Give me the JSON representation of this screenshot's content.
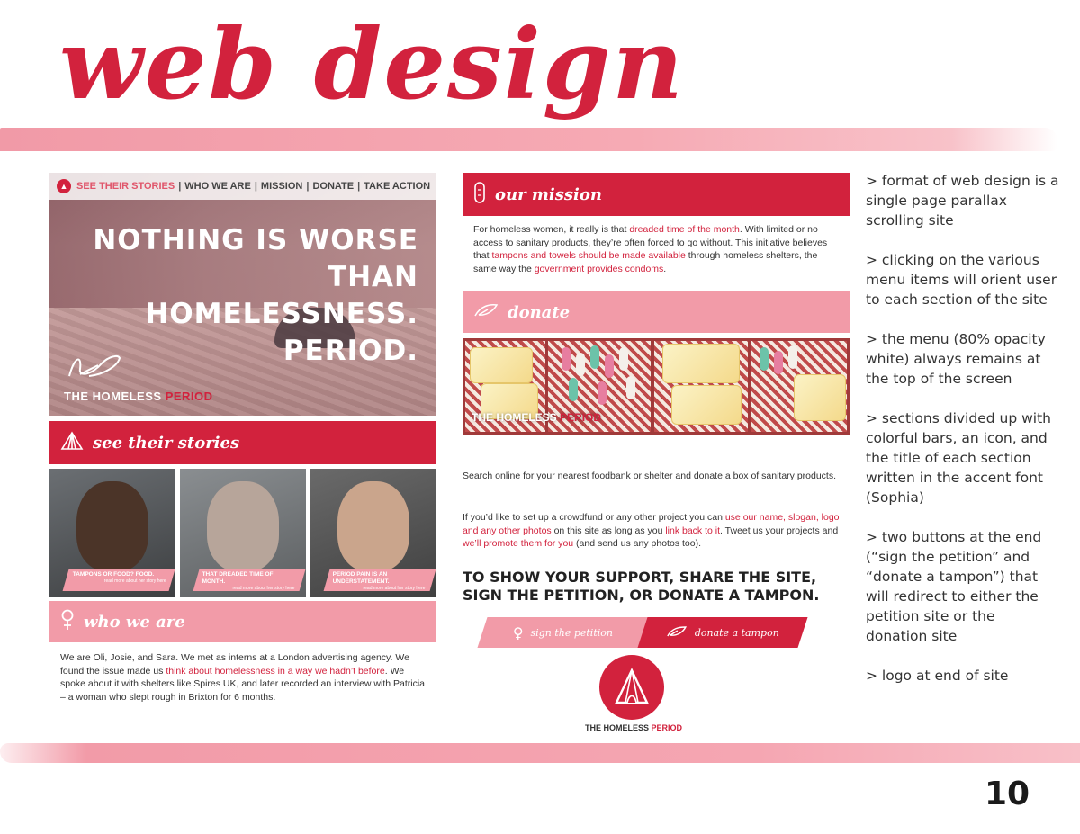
{
  "page": {
    "title": "web design",
    "page_number": "10"
  },
  "site": {
    "nav": {
      "items": [
        "SEE THEIR STORIES",
        "WHO WE ARE",
        "MISSION",
        "DONATE",
        "TAKE ACTION"
      ],
      "separator": "|"
    },
    "hero": {
      "headline_lines": [
        "NOTHING IS WORSE",
        "THAN HOMELESSNESS.",
        "PERIOD."
      ],
      "brand_prefix": "THE HOMELESS",
      "brand_accent": "PERIOD"
    },
    "stories": {
      "bar_label": "see their stories",
      "cards": [
        {
          "caption": "TAMPONS OR FOOD? FOOD.",
          "link": "read more about her story here"
        },
        {
          "caption": "THAT DREADED TIME OF MONTH.",
          "link": "read more about her story here"
        },
        {
          "caption": "PERIOD PAIN IS AN UNDERSTATEMENT.",
          "link": "read more about her story here"
        }
      ]
    },
    "who": {
      "bar_label": "who we are",
      "text_1": "We are Oli, Josie, and Sara. We met as interns at a London advertising agency. We found the issue made us ",
      "text_hl": "think about homelessness in a way we hadn’t before",
      "text_2": ". We spoke about it with shelters like Spires UK, and later recorded an interview with Patricia – a woman who slept rough in Brixton for 6 months."
    },
    "mission": {
      "bar_label": "our mission",
      "t1": "For homeless women, it really is that ",
      "hl1": "dreaded time of the month",
      "t2": ". With limited or no access to sanitary products, they’re often forced to go without. This initiative believes that ",
      "hl2": "tampons and towels should be made available",
      "t3": " through homeless shelters, the same way the ",
      "hl3": "government provides condoms",
      "t4": "."
    },
    "donate": {
      "bar_label": "donate",
      "brand_prefix": "THE HOMELESS",
      "brand_accent": "PERIOD",
      "text_a": "Search online for your nearest foodbank or shelter and donate a box of sanitary products.",
      "b1": "If you’d like to set up a crowdfund or any other project you can ",
      "bh1": "use our name, slogan, logo and any other photos",
      "b2": " on this site as long as you ",
      "bh2": "link back to it",
      "b3": ". Tweet us your projects and ",
      "bh3": "we’ll promote them for you",
      "b4": " (and send us any photos too)."
    },
    "cta": {
      "line1": "TO SHOW YOUR SUPPORT, SHARE THE SITE,",
      "line2": "SIGN THE PETITION, OR DONATE A TAMPON.",
      "petition_label": "sign the petition",
      "donate_label": "donate a tampon"
    },
    "end_logo": {
      "brand_prefix": "THE HOMELESS",
      "brand_accent": "PERIOD"
    }
  },
  "notes": [
    "> format of web design is a single page parallax scrolling site",
    "> clicking on the various menu items will orient user to each section of the site",
    "> the menu (80% opacity white) always remains at the top of the screen",
    "> sections divided up with colorful bars, an icon, and the title of each section written in the accent font (Sophia)",
    "> two buttons at the end (“sign the petition” and “donate a tampon”) that will redirect to either the petition site or the donation site",
    "> logo at end of site"
  ],
  "colors": {
    "accent_red": "#d2223d",
    "accent_pink": "#f29ba8"
  },
  "icons": {
    "stories": "tent-icon",
    "who": "female-symbol-icon",
    "mission": "pad-icon",
    "donate": "feather-icon",
    "logo": "teepee-logo-icon"
  }
}
